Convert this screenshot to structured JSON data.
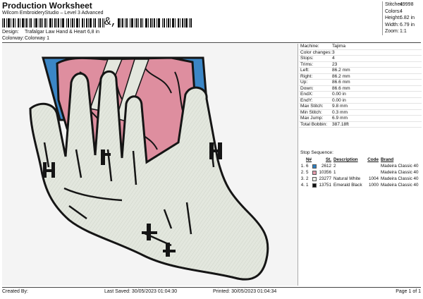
{
  "header": {
    "title": "Production Worksheet",
    "subtitle": "Wilcom EmbroideryStudio – Level 3 Advanced",
    "barcode_text": "&,"
  },
  "meta": {
    "design_label": "Design:",
    "design_value": "Trafalgar Law Hand & Heart 6,8 in",
    "colorway_label": "Colorway:",
    "colorway_value": "Colorway 1"
  },
  "stats": [
    {
      "label": "Stitches:",
      "value": "49998"
    },
    {
      "label": "Colors:",
      "value": "4"
    },
    {
      "label": "Height:",
      "value": "6.82 in"
    },
    {
      "label": "Width:",
      "value": "6.79 in"
    },
    {
      "label": "Zoom:",
      "value": "1:1"
    }
  ],
  "info": [
    {
      "label": "Machine:",
      "value": "Tajima"
    },
    {
      "label": "Color changes:",
      "value": "3"
    },
    {
      "label": "Stops:",
      "value": "4"
    },
    {
      "label": "Trims:",
      "value": "23"
    },
    {
      "label": "Left:",
      "value": "86.2 mm"
    },
    {
      "label": "Right:",
      "value": "86.2 mm"
    },
    {
      "label": "Up:",
      "value": "86.6 mm"
    },
    {
      "label": "Down:",
      "value": "86.6 mm"
    },
    {
      "label": "EndX:",
      "value": "0.00 in"
    },
    {
      "label": "EndY:",
      "value": "0.00 in"
    },
    {
      "label": "Max Stitch:",
      "value": "9.8 mm"
    },
    {
      "label": "Min Stitch:",
      "value": "0.3 mm"
    },
    {
      "label": "Max Jump:",
      "value": "6.9 mm"
    },
    {
      "label": "Total Bobbin:",
      "value": "387.18ft"
    }
  ],
  "stop_sequence": {
    "title": "Stop Sequence:",
    "headers": {
      "n": "N#",
      "st": "St.",
      "desc": "Description",
      "code": "Code",
      "brand": "Brand"
    },
    "rows": [
      {
        "idx": "1.",
        "n": "6",
        "color": "#2f7fc0",
        "st": "2612",
        "desc": "2",
        "code": "",
        "brand": "Madeira Classic 40"
      },
      {
        "idx": "2.",
        "n": "5",
        "color": "#e39bab",
        "st": "10356",
        "desc": "1",
        "code": "",
        "brand": "Madeira Classic 40"
      },
      {
        "idx": "3.",
        "n": "2",
        "color": "#ecefe8",
        "st": "23277",
        "desc": "Natural White",
        "code": "1004",
        "brand": "Madeira Classic 40"
      },
      {
        "idx": "4.",
        "n": "1",
        "color": "#111111",
        "st": "13751",
        "desc": "Emerald Black",
        "code": "1000",
        "brand": "Madeira Classic 40"
      }
    ]
  },
  "footer": {
    "created": "Created By:",
    "saved": "Last Saved: 30/05/2023 01:04:30",
    "printed": "Printed: 30/05/2023 01:04:34",
    "page": "Page 1 of 1"
  },
  "design_colors": {
    "blue": "#3b86c6",
    "pink": "#de8e9f",
    "white": "#e3e7de",
    "black": "#151515"
  }
}
